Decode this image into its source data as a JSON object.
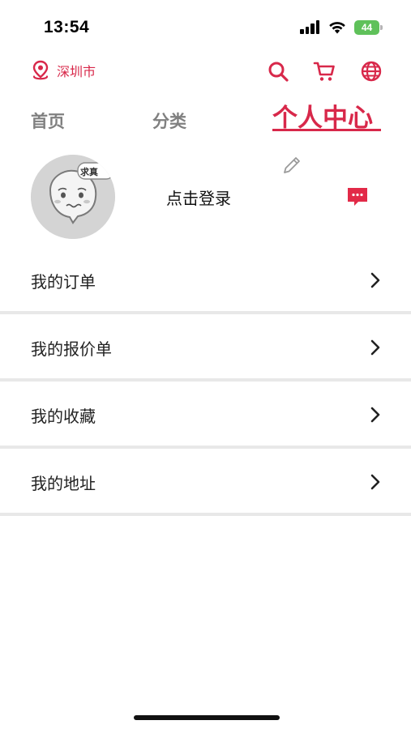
{
  "status_bar": {
    "time": "13:54",
    "battery_level": "44",
    "icons": [
      "signal-icon",
      "wifi-icon",
      "battery-icon"
    ]
  },
  "header": {
    "location": "深圳市",
    "icons": [
      "location-pin-icon",
      "search-icon",
      "cart-icon",
      "globe-icon"
    ],
    "accent_color": "#d8284a"
  },
  "tabs": {
    "home": "首页",
    "category": "分类",
    "profile": "个人中心",
    "active": "profile"
  },
  "profile": {
    "avatar_badge": "求真",
    "login_label": "点击登录",
    "icons": [
      "avatar-icon",
      "edit-pencil-icon",
      "message-icon"
    ]
  },
  "menu": {
    "items": [
      {
        "label": "我的订单"
      },
      {
        "label": "我的报价单"
      },
      {
        "label": "我的收藏"
      },
      {
        "label": "我的地址"
      }
    ],
    "chevron_icon": "chevron-right-icon"
  }
}
